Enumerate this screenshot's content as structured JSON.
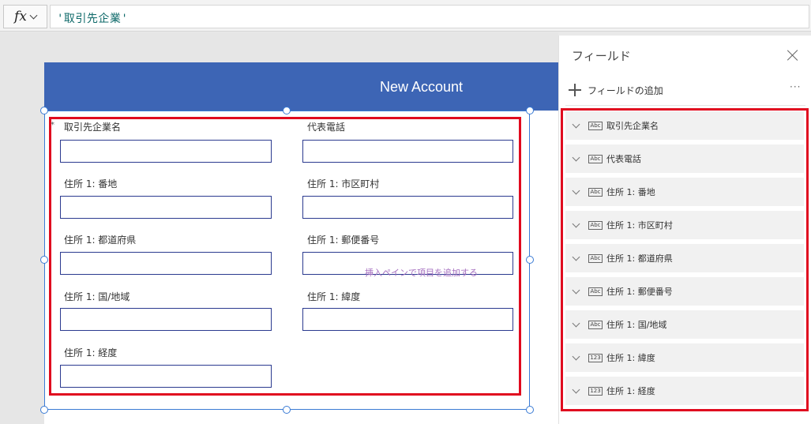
{
  "formula_bar": {
    "fx_label": "fx",
    "formula": "'取引先企業'"
  },
  "screen": {
    "title": "New Account",
    "required_marker": "*",
    "fields": [
      {
        "label": "取引先企業名"
      },
      {
        "label": "代表電話"
      },
      {
        "label": "住所 1: 番地"
      },
      {
        "label": "住所 1: 市区町村"
      },
      {
        "label": "住所 1: 都道府県"
      },
      {
        "label": "住所 1: 郵便番号"
      },
      {
        "label": "住所 1: 国/地域"
      },
      {
        "label": "住所 1: 緯度"
      },
      {
        "label": "住所 1: 経度"
      }
    ],
    "hint": "挿入ペインで項目を追加する"
  },
  "pane": {
    "title": "フィールド",
    "add_field_label": "フィールドの追加",
    "more_label": "···",
    "fields": [
      {
        "label": "取引先企業名",
        "type_icon": "Abc"
      },
      {
        "label": "代表電話",
        "type_icon": "Abc"
      },
      {
        "label": "住所 1: 番地",
        "type_icon": "Abc"
      },
      {
        "label": "住所 1: 市区町村",
        "type_icon": "Abc"
      },
      {
        "label": "住所 1: 都道府県",
        "type_icon": "Abc"
      },
      {
        "label": "住所 1: 郵便番号",
        "type_icon": "Abc"
      },
      {
        "label": "住所 1: 国/地域",
        "type_icon": "Abc"
      },
      {
        "label": "住所 1: 緯度",
        "type_icon": "123"
      },
      {
        "label": "住所 1: 経度",
        "type_icon": "123"
      }
    ]
  },
  "colors": {
    "header": "#3d65b5",
    "highlight": "#e00b1f",
    "selection": "#3a7bd5",
    "input_border": "#2b3a8f"
  }
}
